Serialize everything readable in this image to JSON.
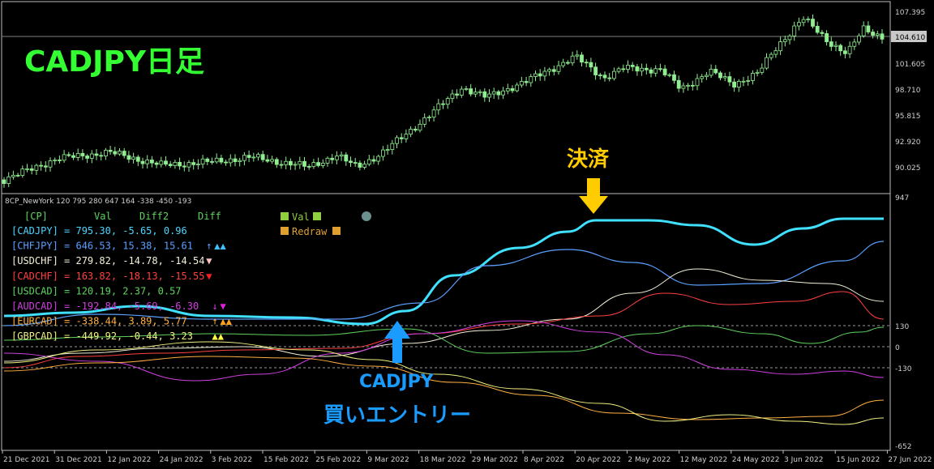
{
  "title": "CADJPY日足",
  "indicator_header": "8CP_NewYork 120 795 280 647 164 -338 -450 -193",
  "price_axis": {
    "ticks": [
      "107.395",
      "104.610",
      "101.605",
      "98.710",
      "95.815",
      "92.920",
      "90.025"
    ],
    "current": "104.610"
  },
  "indicator_axis": {
    "ticks": [
      "947",
      "130",
      "0",
      "-130",
      "-652"
    ]
  },
  "date_axis": [
    "21 Dec 2021",
    "31 Dec 2021",
    "12 Jan 2022",
    "24 Jan 2022",
    "3 Feb 2022",
    "15 Feb 2022",
    "25 Feb 2022",
    "9 Mar 2022",
    "18 Mar 2022",
    "29 Mar 2022",
    "8 Apr 2022",
    "20 Apr 2022",
    "2 May 2022",
    "12 May 2022",
    "24 May 2022",
    "3 Jun 2022",
    "15 Jun 2022",
    "27 Jun 2022"
  ],
  "table": {
    "header": {
      "cp": "[CP]",
      "val": "Val",
      "diff2": "Diff2",
      "diff": "Diff"
    },
    "rows": [
      {
        "text": "[CADJPY] = 795.30,  -5.65,   0.96",
        "color": "#4fd4ff",
        "arrow": "",
        "marks": ""
      },
      {
        "text": "[CHFJPY] = 646.53,  15.38,  15.61",
        "color": "#5aa0ff",
        "arrow": "↑",
        "marks": "▲▲"
      },
      {
        "text": "[USDCHF] = 279.82, -14.78, -14.54",
        "color": "#f4f0d8",
        "arrow": "",
        "marks": "▼"
      },
      {
        "text": "[CADCHF] = 163.82, -18.13, -15.55",
        "color": "#ff4040",
        "arrow": "",
        "marks": "▼"
      },
      {
        "text": "[USDCAD] = 120.19,   2.37,   0.57",
        "color": "#5fd35f",
        "arrow": "",
        "marks": ""
      },
      {
        "text": "[AUDCAD] = -192.84,  -5.69,  -6.30",
        "color": "#d040e0",
        "arrow": "↓",
        "marks": "▼"
      },
      {
        "text": "[EURCAD] = -338.44,   3.89,   5.77",
        "color": "#ffb040",
        "arrow": "↑",
        "marks": "▲▲"
      },
      {
        "text": "[GBPCAD] = -449.92,  -0.44,   3.23",
        "color": "#f0f080",
        "arrow": "",
        "marks": "▲▲"
      }
    ],
    "marks_colors": [
      "",
      "#40c0ff",
      "#ffc0c0",
      "#ff2020",
      "",
      "#e020e0",
      "#ffa020",
      "#ffff40"
    ]
  },
  "legend": {
    "val_label": "Val",
    "redraw_label": "Redraw",
    "val_color": "#90d040",
    "redraw_color": "#e0a030"
  },
  "annotations": {
    "settle": "決済",
    "entry_pair": "CADJPY",
    "entry_text": "買いエントリー",
    "settle_color": "#ffcc00",
    "entry_color": "#1a9cff"
  },
  "colors": {
    "bull_candle": "#000000",
    "bear_candle": "#90ee90",
    "candle_wick": "#90ee90",
    "title_green": "#33ff33"
  }
}
